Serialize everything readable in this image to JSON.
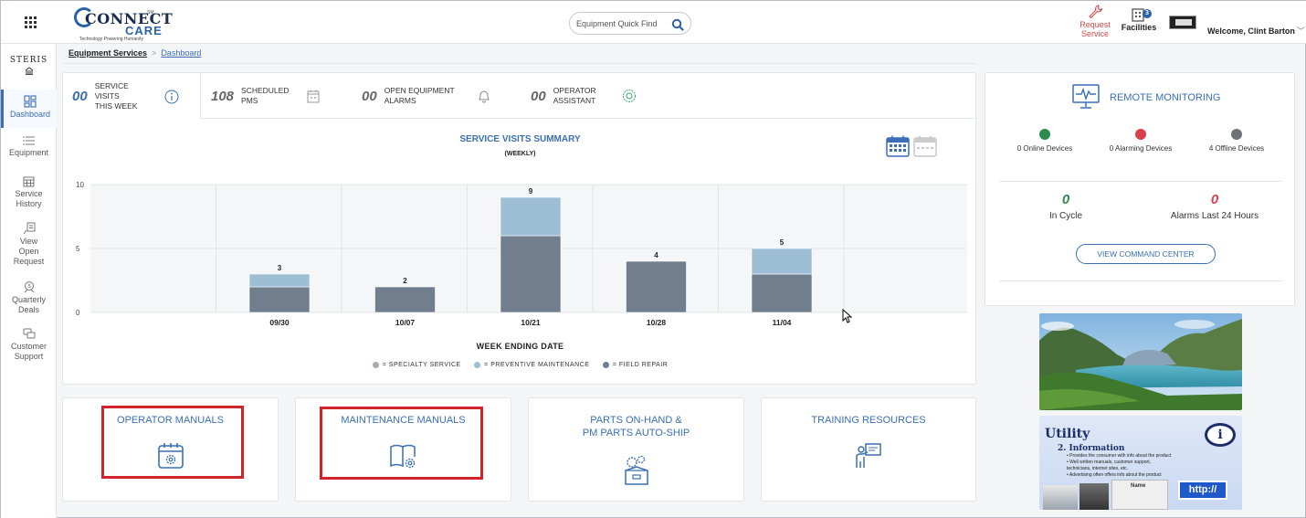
{
  "header": {
    "logo": {
      "word1": "CONNECT",
      "word2": "CARE",
      "tagline": "Technology Powering Humanity",
      "tm": "SM"
    },
    "search_placeholder": "Equipment Quick Find",
    "request_service_line1": "Request",
    "request_service_line2": "Service",
    "facilities_label": "Facilities",
    "facilities_badge": "3",
    "welcome": "Welcome, Clint Barton"
  },
  "sidebar": {
    "brand": "STERIS",
    "items": [
      {
        "label": "Dashboard",
        "icon": "dashboard-icon"
      },
      {
        "label": "Equipment",
        "icon": "list-icon"
      },
      {
        "line1": "Service",
        "line2": "History",
        "icon": "calendar-grid-icon"
      },
      {
        "line1": "View",
        "line2": "Open",
        "line3": "Request",
        "icon": "request-icon"
      },
      {
        "line1": "Quarterly",
        "line2": "Deals",
        "icon": "deals-icon"
      },
      {
        "line1": "Customer",
        "line2": "Support",
        "icon": "chat-icon"
      }
    ]
  },
  "breadcrumb": {
    "root": "Equipment Services",
    "separator": ">",
    "current": "Dashboard"
  },
  "stats": [
    {
      "value": "00",
      "line1": "SERVICE",
      "line2": "VISITS",
      "line3": "THIS WEEK",
      "icon": "info-icon"
    },
    {
      "value": "108",
      "line1": "SCHEDULED",
      "line2": "PMs",
      "icon": "calendar-icon"
    },
    {
      "value": "00",
      "line1": "OPEN EQUIPMENT",
      "line2": "ALARMS",
      "icon": "bell-icon"
    },
    {
      "value": "00",
      "line1": "OPERATOR",
      "line2": "ASSISTANT",
      "icon": "assistant-icon"
    }
  ],
  "chart_header": {
    "title": "SERVICE VISITS SUMMARY",
    "subtitle": "(WEEKLY)"
  },
  "chart_data": {
    "type": "bar",
    "stacked": true,
    "title": "SERVICE VISITS SUMMARY",
    "subtitle": "(WEEKLY)",
    "xlabel": "WEEK ENDING DATE",
    "ylabel": "",
    "ylim": [
      0,
      10
    ],
    "yticks": [
      0,
      5,
      10
    ],
    "grid": true,
    "legend_position": "bottom",
    "categories": [
      "09/30",
      "10/07",
      "10/21",
      "10/28",
      "11/04"
    ],
    "series": [
      {
        "name": "SPECIALTY SERVICE",
        "color": "#a9adb3",
        "values": [
          0,
          0,
          0,
          0,
          0
        ]
      },
      {
        "name": "PREVENTIVE MAINTENANCE",
        "color": "#9dbed4",
        "values": [
          1,
          0,
          3,
          0,
          2
        ]
      },
      {
        "name": "FIELD REPAIR",
        "color": "#717e8e",
        "values": [
          2,
          2,
          6,
          4,
          3
        ]
      }
    ],
    "totals": [
      3,
      2,
      9,
      4,
      5
    ]
  },
  "legend_labels": {
    "specialty": "= SPECIALTY SERVICE",
    "preventive": "= PREVENTIVE MAINTENANCE",
    "field": "= FIELD REPAIR"
  },
  "tiles": [
    {
      "label": "OPERATOR MANUALS",
      "icon": "calendar-gear-icon",
      "highlighted": true
    },
    {
      "label": "MAINTENANCE MANUALS",
      "icon": "book-gear-icon",
      "highlighted": true
    },
    {
      "line1": "PARTS ON-HAND &",
      "line2": "PM PARTS AUTO-SHIP",
      "icon": "box-gear-icon"
    },
    {
      "label": "TRAINING RESOURCES",
      "icon": "presenter-icon"
    }
  ],
  "remote_monitoring": {
    "title": "REMOTE MONITORING",
    "online": {
      "label": "0 Online Devices",
      "color": "#2e8b4e"
    },
    "alarming": {
      "label": "0 Alarming Devices",
      "color": "#d9414b"
    },
    "offline": {
      "label": "4 Offline Devices",
      "color": "#6e737a"
    },
    "in_cycle_value": "0",
    "in_cycle_label": "In Cycle",
    "alarms_value": "0",
    "alarms_label": "Alarms Last 24 Hours",
    "button": "VIEW COMMAND CENTER"
  },
  "ads": {
    "utility": {
      "title": "Utility",
      "subtitle": "2. Information",
      "bullets": [
        "• Provides the consumer with info about the product",
        "• Well written manuals, customer support,",
        "  technicians, internet sites, etc.",
        "• Advertising often offers info about the product"
      ],
      "info_glyph": "i",
      "http": "http://"
    }
  },
  "colors": {
    "accent": "#3a6fb5",
    "highlight_box": "#d2232a",
    "alarm_value": "#d9414b",
    "online_value": "#2e8b4e"
  }
}
